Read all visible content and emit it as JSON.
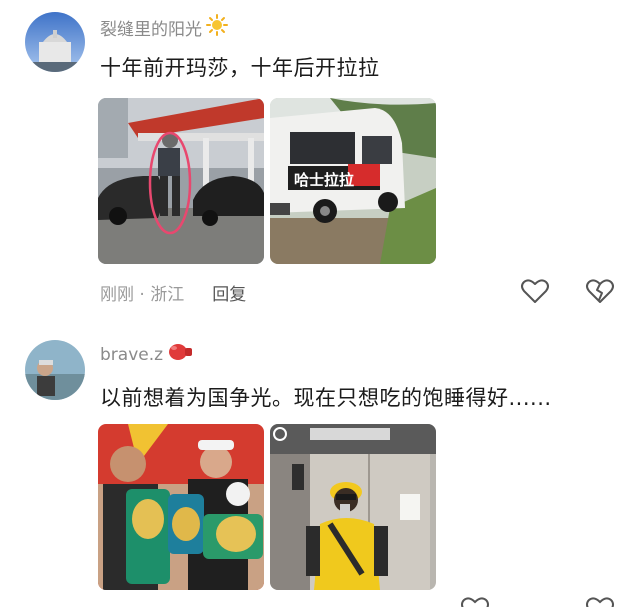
{
  "comments": [
    {
      "username": "裂缝里的阳光",
      "badge_icon": "sun-icon",
      "text": "十年前开玛莎，十年后开拉拉",
      "photos": [
        {
          "icon": "sports-car-photo"
        },
        {
          "icon": "white-van-photo",
          "sign_text": "哈士拉拉"
        }
      ],
      "time": "刚刚",
      "location": "浙江",
      "reply_label": "回复",
      "actions": [
        "heart-icon",
        "broken-heart-icon"
      ]
    },
    {
      "username": "brave.z",
      "badge_icon": "boxing-glove-icon",
      "text": "以前想着为国争光。现在只想吃的饱睡得好......",
      "photos": [
        {
          "icon": "boxing-champion-photo"
        },
        {
          "icon": "elevator-courier-photo"
        }
      ]
    }
  ],
  "meta_separator": "·",
  "colors": {
    "username": "#8a8a8a",
    "text": "#1b1b1b",
    "meta": "#9a9a9a"
  }
}
